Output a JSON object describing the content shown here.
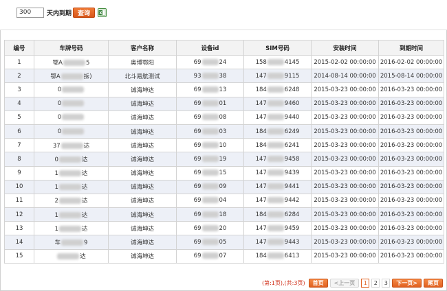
{
  "filter": {
    "days_value": "300",
    "days_label": "天内到期",
    "query_label": "查询",
    "export_icon": "excel-icon"
  },
  "table": {
    "headers": [
      "编号",
      "车牌号码",
      "客户名称",
      "设备id",
      "SIM号码",
      "安装时间",
      "到期时间"
    ],
    "rows": [
      {
        "no": "1",
        "plate_a": "鄂A",
        "plate_b": "5",
        "customer": "奥博鄂阳",
        "dev_a": "69",
        "dev_b": "24",
        "sim_a": "158",
        "sim_b": "4145",
        "install": "2015-02-02 00:00:00",
        "expire": "2016-02-02 00:00:00"
      },
      {
        "no": "2",
        "plate_a": "鄂A",
        "plate_b": "拆)",
        "customer": "北斗易航测试",
        "dev_a": "93",
        "dev_b": "38",
        "sim_a": "147",
        "sim_b": "9115",
        "install": "2014-08-14 00:00:00",
        "expire": "2015-08-14 00:00:00"
      },
      {
        "no": "3",
        "plate_a": "0",
        "plate_b": "",
        "customer": "诚海坤达",
        "dev_a": "69",
        "dev_b": "13",
        "sim_a": "184",
        "sim_b": "6248",
        "install": "2015-03-23 00:00:00",
        "expire": "2016-03-23 00:00:00"
      },
      {
        "no": "4",
        "plate_a": "0",
        "plate_b": "",
        "customer": "诚海坤达",
        "dev_a": "69",
        "dev_b": "01",
        "sim_a": "147",
        "sim_b": "9460",
        "install": "2015-03-23 00:00:00",
        "expire": "2016-03-23 00:00:00"
      },
      {
        "no": "5",
        "plate_a": "0",
        "plate_b": "",
        "customer": "诚海坤达",
        "dev_a": "69",
        "dev_b": "08",
        "sim_a": "147",
        "sim_b": "9440",
        "install": "2015-03-23 00:00:00",
        "expire": "2016-03-23 00:00:00"
      },
      {
        "no": "6",
        "plate_a": "0",
        "plate_b": "",
        "customer": "诚海坤达",
        "dev_a": "69",
        "dev_b": "03",
        "sim_a": "184",
        "sim_b": "6249",
        "install": "2015-03-23 00:00:00",
        "expire": "2016-03-23 00:00:00"
      },
      {
        "no": "7",
        "plate_a": "37",
        "plate_b": "达",
        "customer": "诚海坤达",
        "dev_a": "69",
        "dev_b": "10",
        "sim_a": "184",
        "sim_b": "6241",
        "install": "2015-03-23 00:00:00",
        "expire": "2016-03-23 00:00:00"
      },
      {
        "no": "8",
        "plate_a": "0",
        "plate_b": "达",
        "customer": "诚海坤达",
        "dev_a": "69",
        "dev_b": "19",
        "sim_a": "147",
        "sim_b": "9458",
        "install": "2015-03-23 00:00:00",
        "expire": "2016-03-23 00:00:00"
      },
      {
        "no": "9",
        "plate_a": "1",
        "plate_b": "达",
        "customer": "诚海坤达",
        "dev_a": "69",
        "dev_b": "15",
        "sim_a": "147",
        "sim_b": "9439",
        "install": "2015-03-23 00:00:00",
        "expire": "2016-03-23 00:00:00"
      },
      {
        "no": "10",
        "plate_a": "1",
        "plate_b": "达",
        "customer": "诚海坤达",
        "dev_a": "69",
        "dev_b": "09",
        "sim_a": "147",
        "sim_b": "9441",
        "install": "2015-03-23 00:00:00",
        "expire": "2016-03-23 00:00:00"
      },
      {
        "no": "11",
        "plate_a": "2",
        "plate_b": "达",
        "customer": "诚海坤达",
        "dev_a": "69",
        "dev_b": "04",
        "sim_a": "147",
        "sim_b": "9442",
        "install": "2015-03-23 00:00:00",
        "expire": "2016-03-23 00:00:00"
      },
      {
        "no": "12",
        "plate_a": "1",
        "plate_b": "达",
        "customer": "诚海坤达",
        "dev_a": "69",
        "dev_b": "18",
        "sim_a": "184",
        "sim_b": "6284",
        "install": "2015-03-23 00:00:00",
        "expire": "2016-03-23 00:00:00"
      },
      {
        "no": "13",
        "plate_a": "1",
        "plate_b": "达",
        "customer": "诚海坤达",
        "dev_a": "69",
        "dev_b": "20",
        "sim_a": "147",
        "sim_b": "9459",
        "install": "2015-03-23 00:00:00",
        "expire": "2016-03-23 00:00:00"
      },
      {
        "no": "14",
        "plate_a": "车",
        "plate_b": "9",
        "customer": "诚海坤达",
        "dev_a": "69",
        "dev_b": "05",
        "sim_a": "147",
        "sim_b": "9443",
        "install": "2015-03-23 00:00:00",
        "expire": "2016-03-23 00:00:00"
      },
      {
        "no": "15",
        "plate_a": "",
        "plate_b": "达",
        "customer": "诚海坤达",
        "dev_a": "69",
        "dev_b": "07",
        "sim_a": "184",
        "sim_b": "6413",
        "install": "2015-03-23 00:00:00",
        "expire": "2016-03-23 00:00:00"
      }
    ]
  },
  "pagination": {
    "info": "(第:1页),(共:3页)",
    "first": "首页",
    "prev": "<上一页",
    "pages": [
      "1",
      "2",
      "3"
    ],
    "current_page": "1",
    "next": "下一页>",
    "last": "尾页"
  },
  "colors": {
    "accent": "#e0601f",
    "row_alt": "#edf0f7",
    "pager_info": "#d0301a"
  }
}
